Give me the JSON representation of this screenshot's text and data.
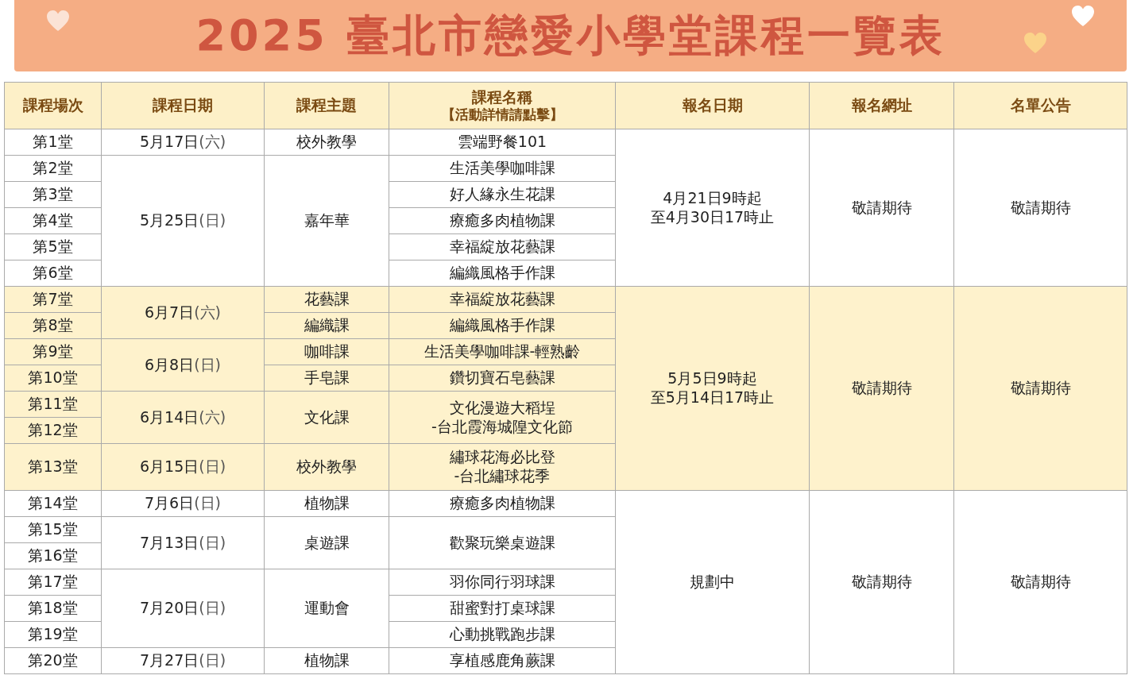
{
  "banner": {
    "title": "2025 臺北市戀愛小學堂課程一覽表"
  },
  "table": {
    "columns": [
      {
        "lines": [
          "課程場次"
        ]
      },
      {
        "lines": [
          "課程日期"
        ]
      },
      {
        "lines": [
          "課程主題"
        ]
      },
      {
        "lines": [
          "課程名稱",
          "【活動詳情請點擊】"
        ]
      },
      {
        "lines": [
          "報名日期"
        ]
      },
      {
        "lines": [
          "報名網址"
        ]
      },
      {
        "lines": [
          "名單公告"
        ]
      }
    ],
    "groups": [
      {
        "shaded": false,
        "registration": [
          "4月21日9時起",
          "至4月30日17時止"
        ],
        "signup_url": "敬請期待",
        "announcement": "敬請期待",
        "dates": [
          {
            "date": "5月17日",
            "weekday": "(六)",
            "topics": [
              {
                "topic": "校外教學",
                "courses": [
                  {
                    "name": [
                      "雲端野餐101"
                    ],
                    "sessions": [
                      "第1堂"
                    ]
                  }
                ]
              }
            ]
          },
          {
            "date": "5月25日",
            "weekday": "(日)",
            "topics": [
              {
                "topic": "嘉年華",
                "courses": [
                  {
                    "name": [
                      "生活美學咖啡課"
                    ],
                    "sessions": [
                      "第2堂"
                    ]
                  },
                  {
                    "name": [
                      "好人緣永生花課"
                    ],
                    "sessions": [
                      "第3堂"
                    ]
                  },
                  {
                    "name": [
                      "療癒多肉植物課"
                    ],
                    "sessions": [
                      "第4堂"
                    ]
                  },
                  {
                    "name": [
                      "幸福綻放花藝課"
                    ],
                    "sessions": [
                      "第5堂"
                    ]
                  },
                  {
                    "name": [
                      "編織風格手作課"
                    ],
                    "sessions": [
                      "第6堂"
                    ]
                  }
                ]
              }
            ]
          }
        ]
      },
      {
        "shaded": true,
        "registration": [
          "5月5日9時起",
          "至5月14日17時止"
        ],
        "signup_url": "敬請期待",
        "announcement": "敬請期待",
        "dates": [
          {
            "date": "6月7日",
            "weekday": "(六)",
            "topics": [
              {
                "topic": "花藝課",
                "courses": [
                  {
                    "name": [
                      "幸福綻放花藝課"
                    ],
                    "sessions": [
                      "第7堂"
                    ]
                  }
                ]
              },
              {
                "topic": "編織課",
                "courses": [
                  {
                    "name": [
                      "編織風格手作課"
                    ],
                    "sessions": [
                      "第8堂"
                    ]
                  }
                ]
              }
            ]
          },
          {
            "date": "6月8日",
            "weekday": "(日)",
            "topics": [
              {
                "topic": "咖啡課",
                "courses": [
                  {
                    "name": [
                      "生活美學咖啡課-輕熟齡"
                    ],
                    "sessions": [
                      "第9堂"
                    ]
                  }
                ]
              },
              {
                "topic": "手皂課",
                "courses": [
                  {
                    "name": [
                      "鑽切寶石皂藝課"
                    ],
                    "sessions": [
                      "第10堂"
                    ]
                  }
                ]
              }
            ]
          },
          {
            "date": "6月14日",
            "weekday": "(六)",
            "topics": [
              {
                "topic": "文化課",
                "courses": [
                  {
                    "name": [
                      "文化漫遊大稻埕",
                      "-台北霞海城隍文化節"
                    ],
                    "sessions": [
                      "第11堂",
                      "第12堂"
                    ]
                  }
                ]
              }
            ]
          },
          {
            "date": "6月15日",
            "weekday": "(日)",
            "topics": [
              {
                "topic": "校外教學",
                "courses": [
                  {
                    "name": [
                      "繡球花海必比登",
                      "-台北繡球花季"
                    ],
                    "sessions": [
                      "第13堂"
                    ]
                  }
                ]
              }
            ]
          }
        ]
      },
      {
        "shaded": false,
        "registration": [
          "規劃中"
        ],
        "signup_url": "敬請期待",
        "announcement": "敬請期待",
        "dates": [
          {
            "date": "7月6日",
            "weekday": "(日)",
            "topics": [
              {
                "topic": "植物課",
                "courses": [
                  {
                    "name": [
                      "療癒多肉植物課"
                    ],
                    "sessions": [
                      "第14堂"
                    ]
                  }
                ]
              }
            ]
          },
          {
            "date": "7月13日",
            "weekday": "(日)",
            "topics": [
              {
                "topic": "桌遊課",
                "courses": [
                  {
                    "name": [
                      "歡聚玩樂桌遊課"
                    ],
                    "sessions": [
                      "第15堂",
                      "第16堂"
                    ]
                  }
                ]
              }
            ]
          },
          {
            "date": "7月20日",
            "weekday": "(日)",
            "topics": [
              {
                "topic": "運動會",
                "courses": [
                  {
                    "name": [
                      "羽你同行羽球課"
                    ],
                    "sessions": [
                      "第17堂"
                    ]
                  },
                  {
                    "name": [
                      "甜蜜對打桌球課"
                    ],
                    "sessions": [
                      "第18堂"
                    ]
                  },
                  {
                    "name": [
                      "心動挑戰跑步課"
                    ],
                    "sessions": [
                      "第19堂"
                    ]
                  }
                ]
              }
            ]
          },
          {
            "date": "7月27日",
            "weekday": "(日)",
            "topics": [
              {
                "topic": "植物課",
                "courses": [
                  {
                    "name": [
                      "享植感鹿角蕨課"
                    ],
                    "sessions": [
                      "第20堂"
                    ]
                  }
                ]
              }
            ]
          }
        ]
      }
    ]
  }
}
